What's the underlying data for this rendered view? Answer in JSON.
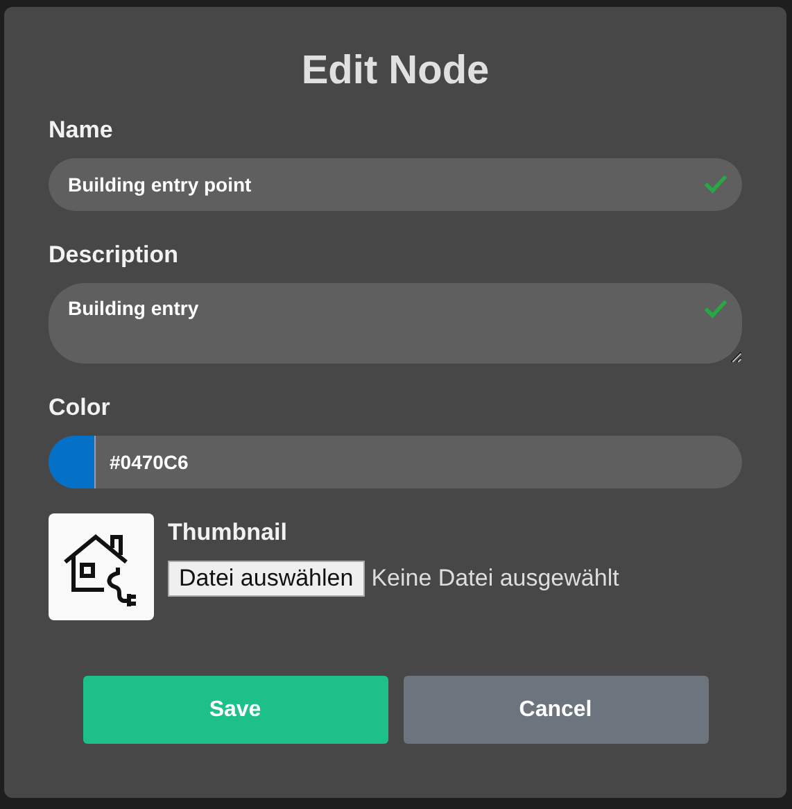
{
  "dialog": {
    "title": "Edit Node"
  },
  "fields": [
    {
      "kind": "text",
      "label": "Name",
      "value": "Building entry point",
      "valid": true
    },
    {
      "kind": "textarea",
      "label": "Description",
      "value": "Building entry",
      "valid": true
    },
    {
      "kind": "color",
      "label": "Color",
      "value": "#0470C6",
      "color": "#0470c6"
    }
  ],
  "thumbnail": {
    "label": "Thumbnail",
    "button": "Datei auswählen",
    "status": "Keine Datei ausgewählt"
  },
  "buttons": [
    {
      "kind": "primary",
      "label": "Save"
    },
    {
      "kind": "secondary",
      "label": "Cancel"
    }
  ]
}
